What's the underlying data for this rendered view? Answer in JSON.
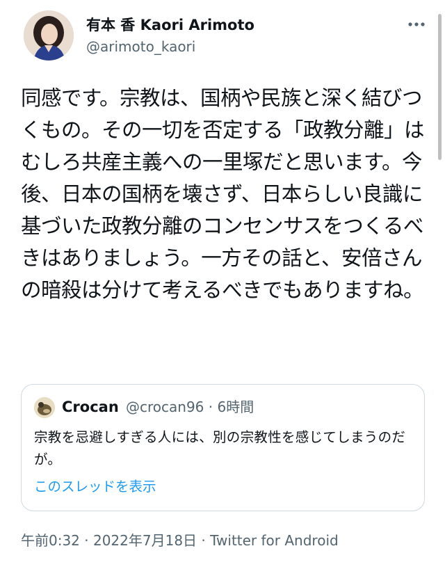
{
  "author": {
    "display_name": "有本 香 Kaori Arimoto",
    "handle": "@arimoto_kaori",
    "avatar_icon": "profile-photo"
  },
  "more_icon": "more-horizontal-icon",
  "tweet": {
    "text": "同感です。宗教は、国柄や民族と深く結びつくもの。その一切を否定する「政教分離」はむしろ共産主義への一里塚だと思います。今後、日本の国柄を壊さず、日本らしい良識に基づいた政教分離のコンセンサスをつくるべきはありましょう。一方その話と、安倍さんの暗殺は分けて考えるべきでもありますね。"
  },
  "quote": {
    "display_name": "Crocan",
    "meta": "@crocan96 · 6時間",
    "text": "宗教を忌避しすぎる人には、別の宗教性を感じてしまうのだが。",
    "show_thread": "このスレッドを表示"
  },
  "timestamp": "午前0:32 · 2022年7月18日 · Twitter for Android",
  "colors": {
    "text": "#0f1419",
    "secondary": "#536471",
    "link": "#1d9bf0",
    "border": "#cfd9de"
  }
}
